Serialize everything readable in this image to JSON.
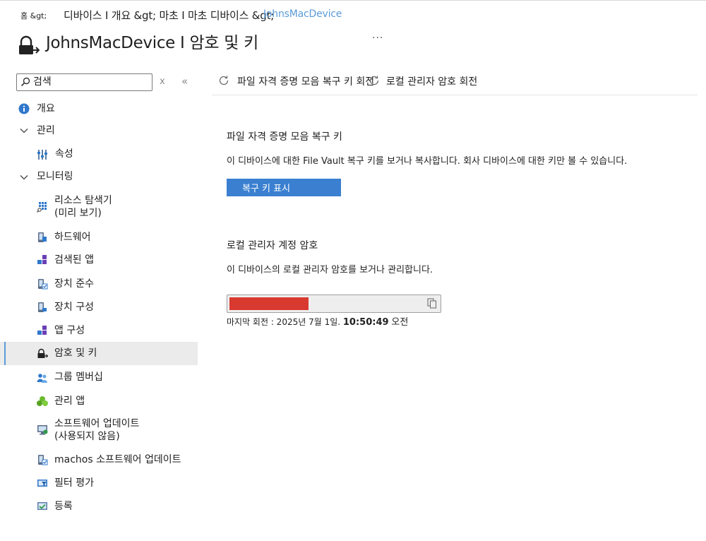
{
  "breadcrumb": {
    "home": "홈 &gt;",
    "path": "디바이스 I 개요 &gt; 마초 I 마초 디바이스 &gt;",
    "device_link": "JohnsMacDevice"
  },
  "page": {
    "title": "JohnsMacDevice I 암호 및 키",
    "more": "..."
  },
  "search": {
    "placeholder": "검색",
    "clear_label": "x",
    "collapse_label": "«"
  },
  "nav": {
    "overview": "개요",
    "group_manage": "관리",
    "properties": "속성",
    "group_monitoring": "모니터링",
    "resource_explorer_line1": "리소스 탐색기",
    "resource_explorer_line2": "(미리 보기)",
    "hardware": "하드웨어",
    "discovered_apps": "검색된 앱",
    "device_compliance": "장치 준수",
    "device_configuration": "장치 구성",
    "app_configuration": "앱 구성",
    "passwords_keys": "암호 및 키",
    "group_membership": "그룹 멤버십",
    "managed_apps": "관리 앱",
    "software_updates_line1": "소프트웨어 업데이트",
    "software_updates_line2": "(사용되지 않음)",
    "macos_software_updates": "machos 소프트웨어 업데이트",
    "filter_evaluation": "필터 평가",
    "enrollment": "등록"
  },
  "toolbar": {
    "rotate_filevault": "파일 자격 증명 모음 복구 키 회전",
    "rotate_admin": "로컬 관리자 암호 회전"
  },
  "filevault": {
    "heading": "파일 자격 증명 모음 복구 키",
    "description": "이 디바이스에 대한 File Vault 복구 키를 보거나 복사합니다. 회사 디바이스에 대한 키만 볼 수 있습니다.",
    "button": "복구 키 표시"
  },
  "local_admin": {
    "heading": "로컬 관리자 계정 암호",
    "description": "이 디바이스의 로컬 관리자 암호를 보거나 관리합니다.",
    "last_rotated_label": "마지막 회전 : 2025년 7월 1일.",
    "last_rotated_time": "10:50:49",
    "last_rotated_ampm": "오전"
  },
  "colors": {
    "accent": "#3a7fd0",
    "link": "#5a9bd8",
    "redaction": "#d83a2f",
    "selected_bg": "#ebebeb"
  }
}
